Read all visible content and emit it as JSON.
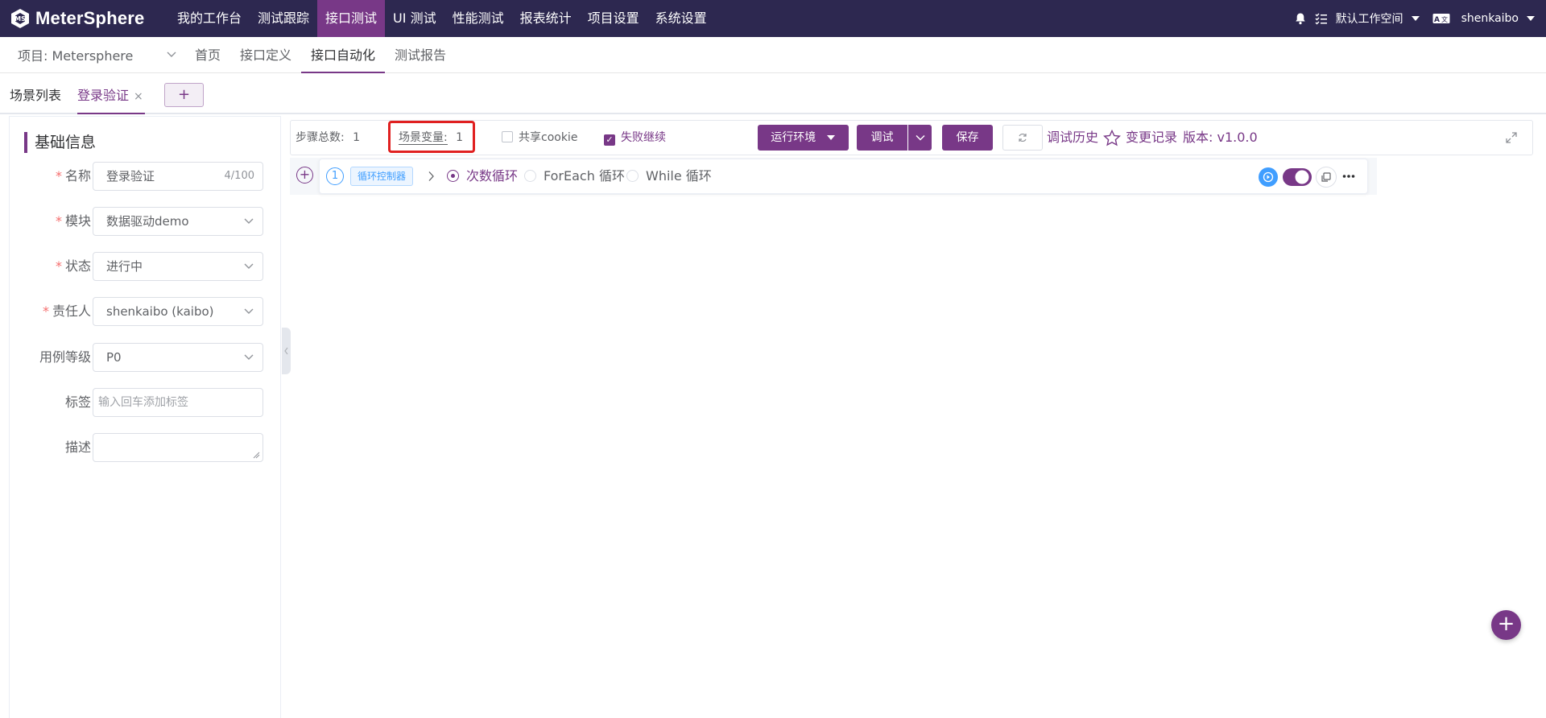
{
  "brand": {
    "name": "MeterSphere",
    "accent": "#783887",
    "topbar_bg": "#2d2850"
  },
  "top_menu": [
    {
      "label": "我的工作台",
      "active": false
    },
    {
      "label": "测试跟踪",
      "active": false
    },
    {
      "label": "接口测试",
      "active": true
    },
    {
      "label": "UI 测试",
      "active": false
    },
    {
      "label": "性能测试",
      "active": false
    },
    {
      "label": "报表统计",
      "active": false
    },
    {
      "label": "项目设置",
      "active": false
    },
    {
      "label": "系统设置",
      "active": false
    }
  ],
  "top_right": {
    "workspace": "默认工作空间",
    "user": "shenkaibo",
    "icons": [
      "bell-icon",
      "task-list-icon",
      "language-icon"
    ]
  },
  "sub_nav": {
    "project": "项目: Metersphere",
    "items": [
      {
        "label": "首页",
        "active": false
      },
      {
        "label": "接口定义",
        "active": false
      },
      {
        "label": "接口自动化",
        "active": true
      },
      {
        "label": "测试报告",
        "active": false
      }
    ]
  },
  "tabs": {
    "list_tab": "场景列表",
    "active_tab": "登录验证",
    "close": "×",
    "add": "+"
  },
  "basic_info": {
    "title": "基础信息",
    "fields": [
      {
        "label": "名称",
        "required": true,
        "value": "登录验证",
        "counter": "4/100"
      },
      {
        "label": "模块",
        "required": true,
        "value": "数据驱动demo"
      },
      {
        "label": "状态",
        "required": true,
        "value": "进行中"
      },
      {
        "label": "责任人",
        "required": true,
        "value": "shenkaibo (kaibo)"
      },
      {
        "label": "用例等级",
        "required": false,
        "value": "P0"
      },
      {
        "label": "标签",
        "required": false,
        "placeholder": "输入回车添加标签"
      },
      {
        "label": "描述",
        "required": false,
        "value": ""
      }
    ]
  },
  "toolbar": {
    "step_total_label": "步骤总数:",
    "step_total": "1",
    "scene_var_label": "场景变量:",
    "scene_var": "1",
    "share_cookie": "共享cookie",
    "share_cookie_checked": false,
    "fail_continue": "失败继续",
    "fail_continue_checked": true,
    "env_button": "运行环境",
    "debug_button": "调试",
    "save_button": "保存",
    "debug_history": "调试历史",
    "change_record": "变更记录",
    "version": "版本: v1.0.0"
  },
  "step": {
    "index": "1",
    "tag": "循环控制器",
    "options": [
      {
        "label": "次数循环",
        "selected": true
      },
      {
        "label": "ForEach 循环",
        "selected": false
      },
      {
        "label": "While 循环",
        "selected": false
      }
    ],
    "enabled": true
  },
  "fab": "+"
}
